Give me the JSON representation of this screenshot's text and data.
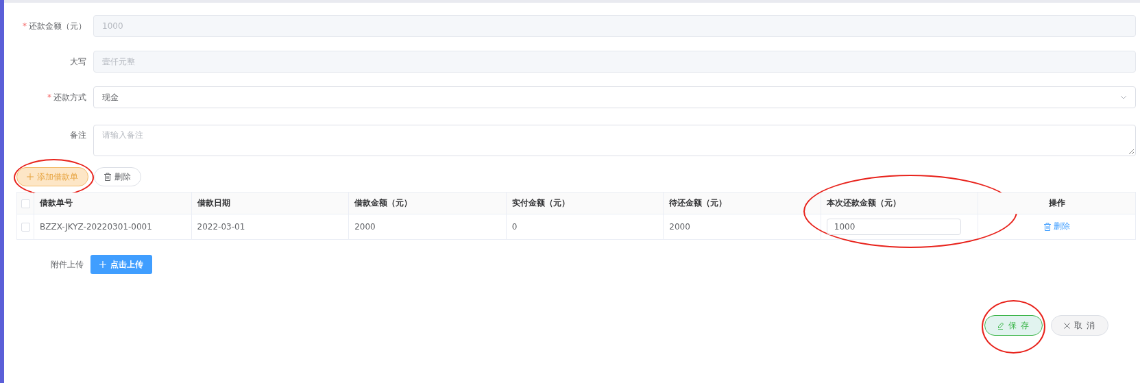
{
  "form": {
    "fields": [
      {
        "kind": "input",
        "label": "还款金额（元）",
        "required_mark": "*",
        "value": "1000",
        "disabled": true
      },
      {
        "kind": "input",
        "label": "大写",
        "value": "壹仟元整",
        "disabled": true
      },
      {
        "kind": "select",
        "label": "还款方式",
        "required_mark": "*",
        "value": "现金"
      },
      {
        "kind": "textarea",
        "label": "备注",
        "placeholder": "请输入备注"
      }
    ]
  },
  "toolbar": [
    {
      "kind": "add",
      "label": "添加借款单",
      "highlighted": true
    },
    {
      "kind": "delete",
      "label": "删除",
      "highlighted": false
    }
  ],
  "table": {
    "header_checked": false,
    "columns": [
      {
        "label": "借款单号",
        "highlighted": false
      },
      {
        "label": "借款日期",
        "highlighted": false
      },
      {
        "label": "借款金额（元）",
        "highlighted": false
      },
      {
        "label": "实付金额（元）",
        "highlighted": false
      },
      {
        "label": "待还金额（元）",
        "highlighted": false
      },
      {
        "label": "本次还款金额（元）",
        "highlighted": true
      },
      {
        "label": "操作",
        "highlighted": false
      }
    ],
    "rows": [
      {
        "checked": false,
        "cells": [
          "BZZX-JKYZ-20220301-0001",
          "2022-03-01",
          "2000",
          "0",
          "2000"
        ],
        "amount": "1000",
        "action": "删除"
      }
    ]
  },
  "upload": {
    "label": "附件上传",
    "button": "点击上传"
  },
  "footer": [
    {
      "kind": "save",
      "label": "保 存",
      "highlighted": true
    },
    {
      "kind": "cancel",
      "label": "取 消",
      "highlighted": false
    }
  ]
}
